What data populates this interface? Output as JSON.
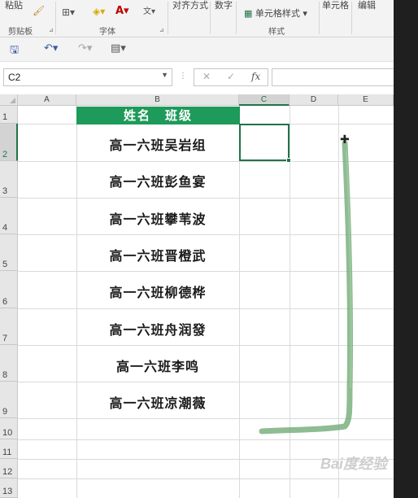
{
  "ribbon": {
    "paste_label": "粘贴",
    "clipboard_label": "剪贴板",
    "font_group_label": "字体",
    "alignment_label": "对齐方式",
    "number_label": "数字",
    "cell_style_label": "单元格样式",
    "styles_label": "样式",
    "cells_label": "单元格",
    "editing_label": "编辑"
  },
  "formula_bar": {
    "name_box": "C2",
    "fx_label": "fx",
    "cancel_icon": "✕",
    "confirm_icon": "✓",
    "value": ""
  },
  "columns": [
    "A",
    "B",
    "C",
    "D",
    "E"
  ],
  "rows": [
    "1",
    "2",
    "3",
    "4",
    "5",
    "6",
    "7",
    "8",
    "9",
    "10",
    "11",
    "12",
    "13"
  ],
  "selected_cell": "C2",
  "table": {
    "header": "姓名　班级",
    "names": [
      "高一六班吴岩组",
      "高一六班彭鱼宴",
      "高一六班攀苇波",
      "高一六班晋橙武",
      "高一六班柳德桦",
      "高一六班舟润發",
      "高一六班李鸣",
      "高一六班凉潮薇"
    ]
  },
  "watermark": "Bai度经验",
  "colors": {
    "header_fill": "#1e9a5a",
    "selection": "#217346"
  }
}
